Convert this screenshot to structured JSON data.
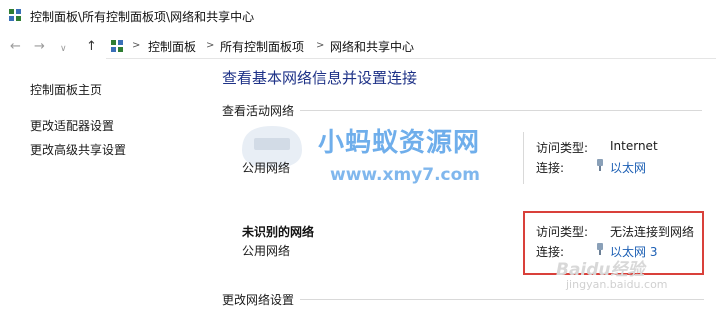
{
  "window": {
    "title": "控制面板\\所有控制面板项\\网络和共享中心",
    "app_icon": "control-panel-icon"
  },
  "nav": {
    "back_icon": "arrow-left-icon",
    "forward_icon": "arrow-right-icon",
    "recent_icon": "chevron-down-icon",
    "up_icon": "arrow-up-icon"
  },
  "address": {
    "icon": "control-panel-icon",
    "separator": ">",
    "crumbs": [
      "控制面板",
      "所有控制面板项",
      "网络和共享中心"
    ]
  },
  "sidebar": {
    "items": [
      {
        "label": "控制面板主页"
      },
      {
        "label": "更改适配器设置"
      },
      {
        "label": "更改高级共享设置"
      }
    ]
  },
  "main": {
    "title": "查看基本网络信息并设置连接",
    "active_section": "查看活动网络",
    "change_section": "更改网络设置",
    "networks": [
      {
        "name": "",
        "type": "公用网络",
        "access_label": "访问类型:",
        "access_value": "Internet",
        "conn_label": "连接:",
        "conn_value": "以太网",
        "conn_icon": "ethernet-icon"
      },
      {
        "name": "未识别的网络",
        "type": "公用网络",
        "access_label": "访问类型:",
        "access_value": "无法连接到网络",
        "conn_label": "连接:",
        "conn_value": "以太网 3",
        "conn_icon": "ethernet-icon"
      }
    ]
  },
  "annotation": {
    "highlight_color": "#d9403a"
  },
  "watermarks": {
    "line1": "小蚂蚁资源网",
    "line2": "www.xmy7.com",
    "line3": "Baidu经验",
    "line4": "jingyan.baidu.com"
  }
}
